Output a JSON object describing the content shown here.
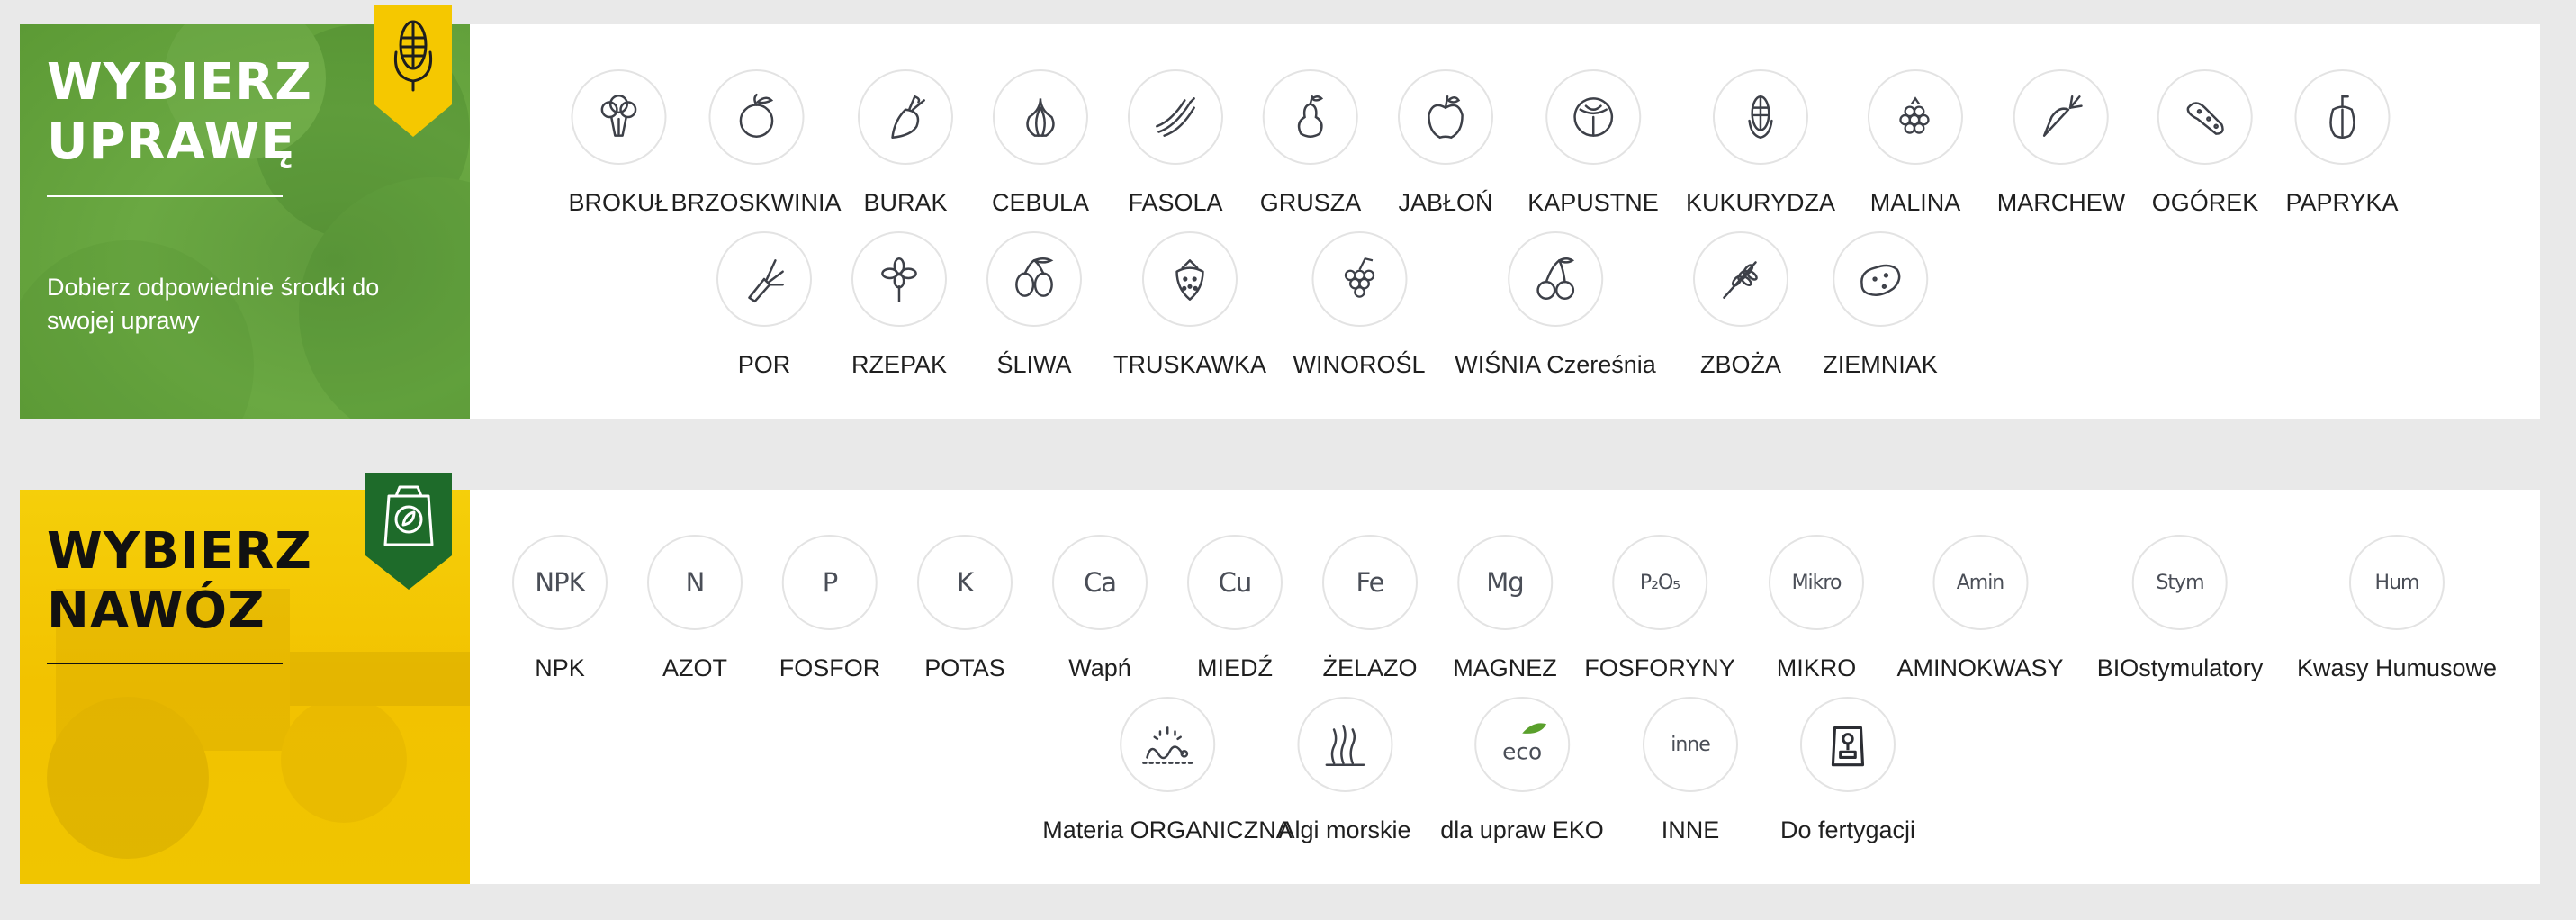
{
  "crops": {
    "title_line1": "WYBIERZ",
    "title_line2": "UPRAWĘ",
    "description": "Dobierz odpowiednie środki do swojej uprawy",
    "badge_icon": "corn-icon",
    "badge_color": "#f5c800",
    "rows": [
      [
        {
          "label": "BROKUŁ",
          "icon": "broccoli-icon"
        },
        {
          "label": "BRZOSKWINIA",
          "icon": "peach-icon"
        },
        {
          "label": "BURAK",
          "icon": "beet-icon"
        },
        {
          "label": "CEBULA",
          "icon": "onion-icon"
        },
        {
          "label": "FASOLA",
          "icon": "bean-icon"
        },
        {
          "label": "GRUSZA",
          "icon": "pear-icon"
        },
        {
          "label": "JABŁOŃ",
          "icon": "apple-icon"
        },
        {
          "label": "KAPUSTNE",
          "icon": "cabbage-icon"
        },
        {
          "label": "KUKURYDZA",
          "icon": "corn-icon"
        },
        {
          "label": "MALINA",
          "icon": "raspberry-icon"
        },
        {
          "label": "MARCHEW",
          "icon": "carrot-icon"
        },
        {
          "label": "OGÓREK",
          "icon": "cucumber-icon"
        },
        {
          "label": "PAPRYKA",
          "icon": "pepper-icon"
        }
      ],
      [
        {
          "label": "POR",
          "icon": "leek-icon"
        },
        {
          "label": "RZEPAK",
          "icon": "rapeseed-icon"
        },
        {
          "label": "ŚLIWA",
          "icon": "plum-icon"
        },
        {
          "label": "TRUSKAWKA",
          "icon": "strawberry-icon"
        },
        {
          "label": "WINOROŚL",
          "icon": "grapes-icon"
        },
        {
          "label": "WIŚNIA Czereśnia",
          "icon": "cherry-icon"
        },
        {
          "label": "ZBOŻA",
          "icon": "wheat-icon"
        },
        {
          "label": "ZIEMNIAK",
          "icon": "potato-icon"
        }
      ]
    ]
  },
  "fertilizers": {
    "title_line1": "WYBIERZ",
    "title_line2": "NAWÓZ",
    "badge_icon": "fertilizer-bag-icon",
    "badge_color": "#1e6b2a",
    "rows": [
      [
        {
          "label": "NPK",
          "symbol": "NPK",
          "icon": "npk-icon"
        },
        {
          "label": "AZOT",
          "symbol": "N",
          "icon": "nitrogen-icon"
        },
        {
          "label": "FOSFOR",
          "symbol": "P",
          "icon": "phosphorus-icon"
        },
        {
          "label": "POTAS",
          "symbol": "K",
          "icon": "potassium-icon"
        },
        {
          "label": "Wapń",
          "symbol": "Ca",
          "icon": "calcium-icon"
        },
        {
          "label": "MIEDŹ",
          "symbol": "Cu",
          "icon": "copper-icon"
        },
        {
          "label": "ŻELAZO",
          "symbol": "Fe",
          "icon": "iron-icon"
        },
        {
          "label": "MAGNEZ",
          "symbol": "Mg",
          "icon": "magnesium-icon"
        },
        {
          "label": "FOSFORYNY",
          "symbol": "P₂O₅",
          "icon": "phosphite-icon"
        },
        {
          "label": "MIKRO",
          "symbol": "Mikro",
          "icon": "micro-icon"
        },
        {
          "label": "AMINOKWASY",
          "symbol": "Amin",
          "icon": "amino-icon"
        },
        {
          "label": "BIOstymulatory",
          "symbol": "Stym",
          "icon": "biostimulant-icon"
        },
        {
          "label": "Kwasy Humusowe",
          "symbol": "Hum",
          "icon": "humic-icon"
        }
      ],
      [
        {
          "label": "Materia ORGANICZNA",
          "icon": "worm-icon"
        },
        {
          "label": "Algi morskie",
          "icon": "seaweed-icon"
        },
        {
          "label": "dla upraw EKO",
          "symbol": "eco",
          "icon": "eco-leaf-icon"
        },
        {
          "label": "INNE",
          "symbol": "inne",
          "icon": "other-icon"
        },
        {
          "label": "Do fertygacji",
          "icon": "fertigation-bag-icon"
        }
      ]
    ]
  }
}
